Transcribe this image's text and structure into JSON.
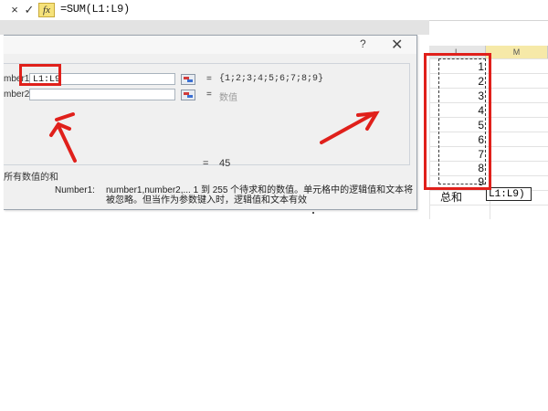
{
  "formula_bar": {
    "cancel_icon": "×",
    "confirm_icon": "✓",
    "fx_icon": "fx",
    "formula": "=SUM(L1:L9)"
  },
  "dialog": {
    "help_glyph": "?",
    "close_glyph": "✕",
    "arg1": {
      "label": "mber1",
      "value": "L1:L9",
      "preview": "{1;2;3;4;5;6;7;8;9}"
    },
    "arg2": {
      "label": "mber2",
      "value": "",
      "preview": "数值"
    },
    "equals": "=",
    "result": "45",
    "function_description": "所有数值的和",
    "help_arg_name": "Number1:",
    "help_arg_text": "number1,number2,... 1 到 255 个待求和的数值。单元格中的逻辑值和文本将被忽略。但当作为参数键入时，逻辑值和文本有效"
  },
  "sheet": {
    "columns": [
      "L",
      "M"
    ],
    "values": [
      "1",
      "2",
      "3",
      "4",
      "5",
      "6",
      "7",
      "8",
      "9"
    ],
    "total_label": "总和",
    "total_cell": "L1:L9)"
  },
  "colors": {
    "highlight": "#e0201b",
    "fx_button": "#f6e27a",
    "active_column": "#f6e9a8"
  }
}
